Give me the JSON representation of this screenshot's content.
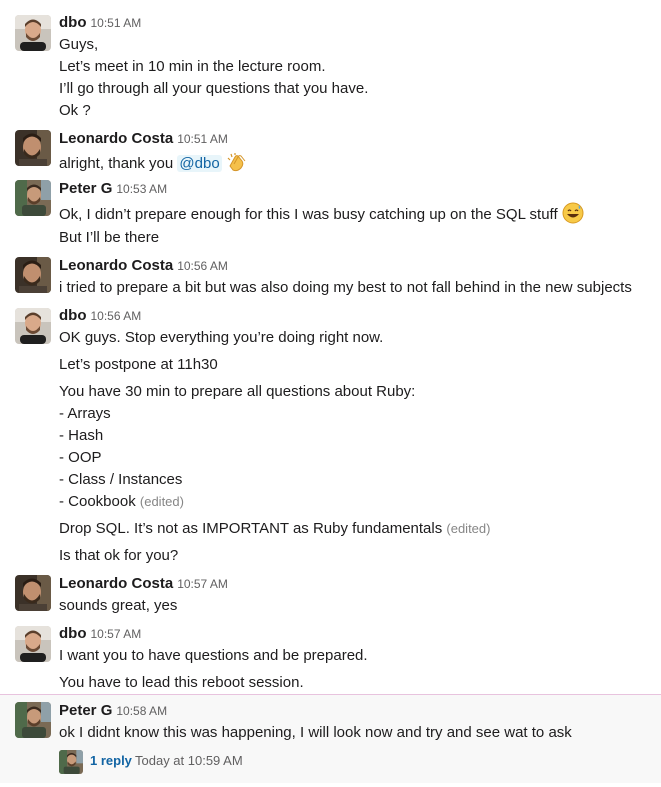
{
  "messages": [
    {
      "user": "dbo",
      "time": "10:51 AM",
      "lines": [
        "Guys,",
        "Let’s meet in 10 min in the lecture room.",
        "I’ll go through all your questions that you have.",
        "Ok ?"
      ]
    },
    {
      "user": "Leonardo Costa",
      "time": "10:51 AM",
      "line_prefix": "alright, thank you",
      "mention": "@dbo",
      "emoji": "clapping-hands"
    },
    {
      "user": "Peter G",
      "time": "10:53 AM",
      "lines": [
        "Ok, I didn’t prepare enough for this I was busy catching up on the SQL stuff",
        "But I’ll be there"
      ],
      "emoji": "grinning-sweat"
    },
    {
      "user": "Leonardo Costa",
      "time": "10:56 AM",
      "lines": [
        "i tried to prepare a bit but was also doing my best to not fall behind in the new subjects"
      ]
    },
    {
      "user": "dbo",
      "time": "10:56 AM",
      "lines": [
        "OK guys. Stop everything you’re doing right now.",
        "Let’s postpone at 11h30",
        "You have 30 min to prepare all questions about Ruby:",
        "- Arrays",
        "- Hash",
        "- OOP",
        "- Class / Instances",
        "- Cookbook",
        "Drop SQL. It’s not as IMPORTANT as Ruby fundamentals",
        "Is that ok for you?"
      ],
      "edited_label": "(edited)"
    },
    {
      "user": "Leonardo Costa",
      "time": "10:57 AM",
      "lines": [
        "sounds great, yes"
      ]
    },
    {
      "user": "dbo",
      "time": "10:57 AM",
      "lines": [
        "I want you to have questions and be prepared.",
        "You have to lead this reboot session."
      ]
    },
    {
      "user": "Peter G",
      "time": "10:58 AM",
      "lines": [
        "ok I didnt know this was happening, I will look now and try and see wat to ask"
      ]
    }
  ],
  "thread": {
    "reply_count": "1 reply",
    "last_reply": "Today at 10:59 AM"
  },
  "colors": {
    "link": "#1264a3",
    "text": "#1d1c1d",
    "muted": "#616061"
  }
}
